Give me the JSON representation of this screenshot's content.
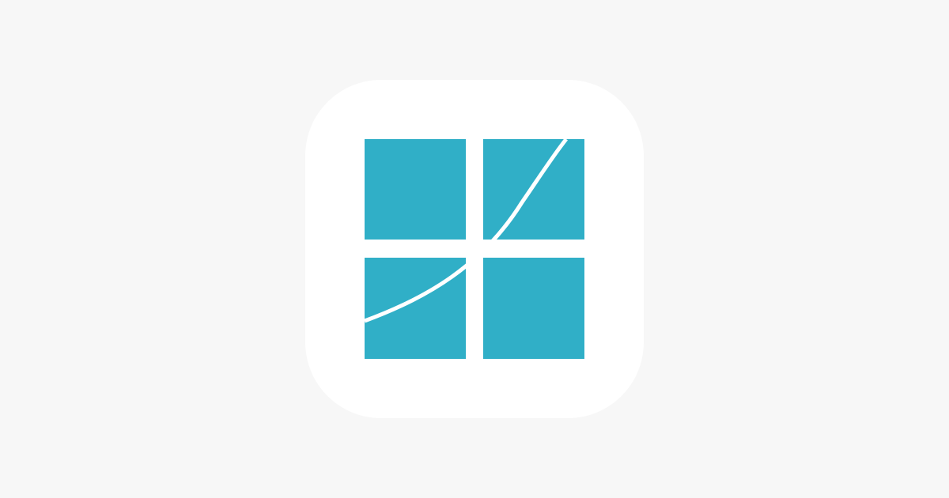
{
  "colors": {
    "background": "#f7f7f7",
    "tile": "#ffffff",
    "accent": "#30afc7",
    "curve": "#ffffff"
  },
  "icon": {
    "name": "grid-curve-app-icon"
  }
}
